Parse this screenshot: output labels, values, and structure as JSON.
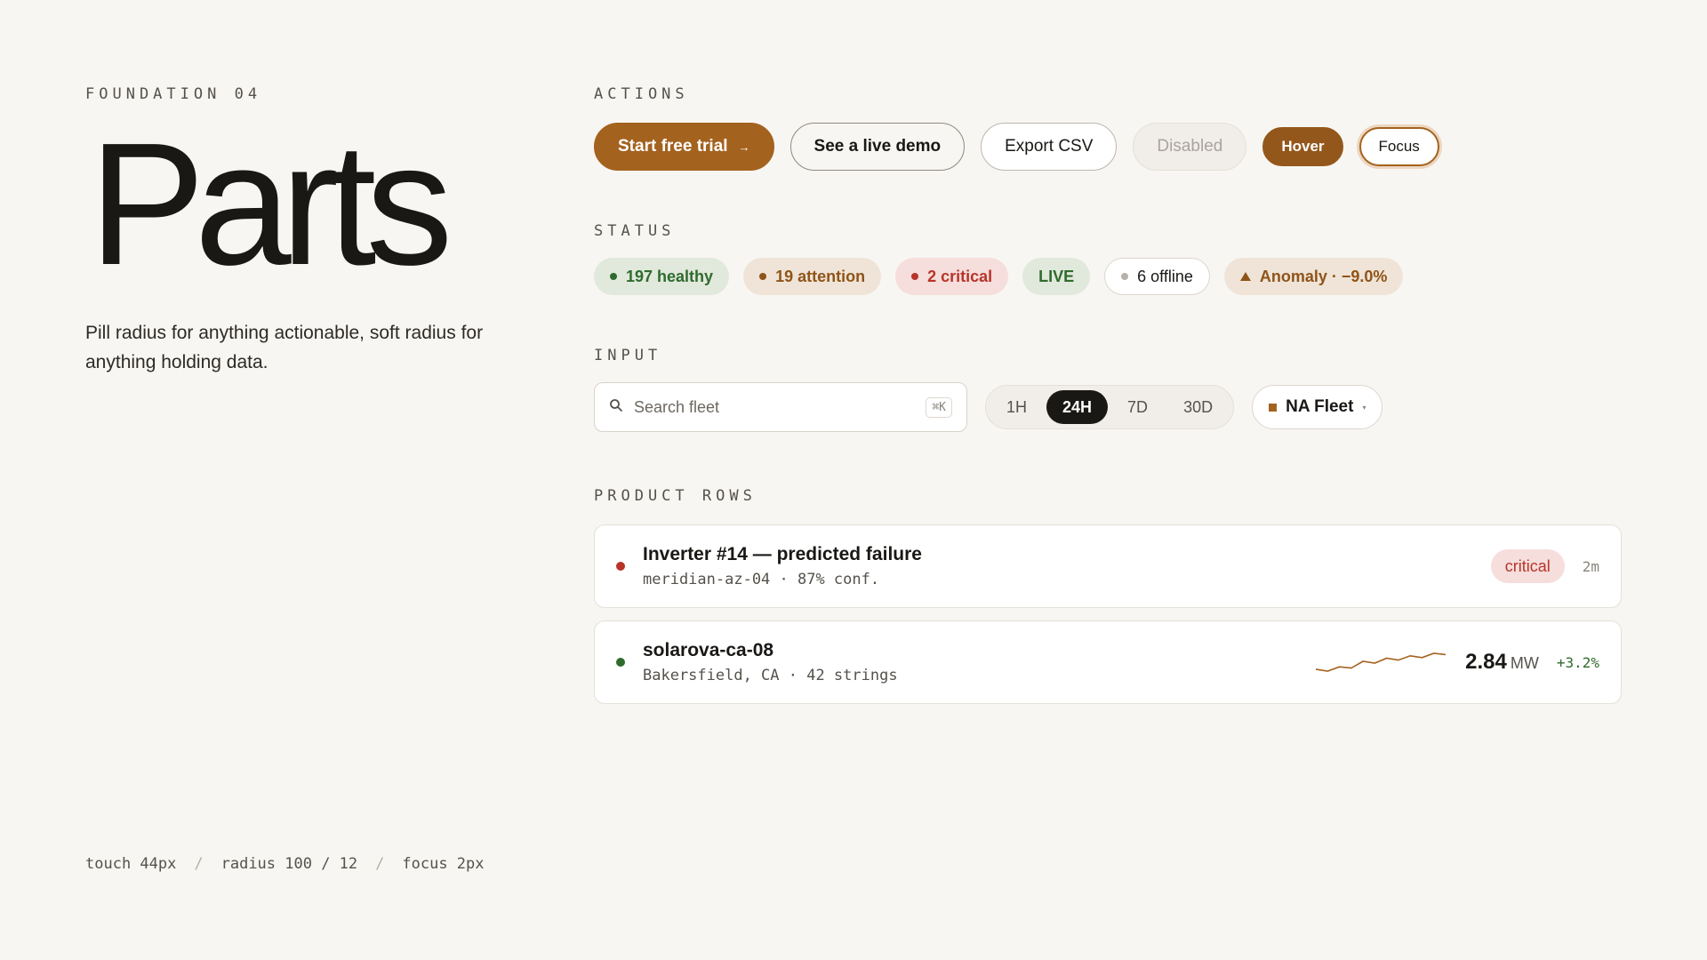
{
  "hero": {
    "eyebrow": "FOUNDATION 04",
    "title": "Parts",
    "description": "Pill radius for anything actionable, soft radius for anything holding data."
  },
  "footer": {
    "items": [
      "touch 44px",
      "radius 100 / 12",
      "focus 2px"
    ],
    "separator": "/"
  },
  "actions": {
    "label": "ACTIONS",
    "start_trial": "Start free trial",
    "arrow": "→",
    "live_demo": "See a live demo",
    "export_csv": "Export CSV",
    "disabled": "Disabled",
    "hover": "Hover",
    "focus": "Focus"
  },
  "status": {
    "label": "STATUS",
    "healthy": "197 healthy",
    "attention": "19 attention",
    "critical": "2 critical",
    "live": "LIVE",
    "offline": "6 offline",
    "anomaly": "Anomaly · −9.0%"
  },
  "input": {
    "label": "INPUT",
    "search_placeholder": "Search fleet",
    "search_shortcut": "⌘K",
    "ranges": [
      "1H",
      "24H",
      "7D",
      "30D"
    ],
    "selected_range": "24H",
    "fleet_select": "NA Fleet",
    "caret": "▾"
  },
  "product_rows": {
    "label": "PRODUCT ROWS",
    "rows": [
      {
        "title": "Inverter #14 — predicted failure",
        "subtitle": "meridian-az-04 · 87% conf.",
        "badge": "critical",
        "age": "2m"
      },
      {
        "title": "solarova-ca-08",
        "subtitle": "Bakersfield, CA · 42 strings",
        "value": "2.84",
        "unit": "MW",
        "delta": "+3.2%",
        "sparkline": [
          3.0,
          3.3,
          2.6,
          2.8,
          1.7,
          2.0,
          1.2,
          1.5,
          0.8,
          1.1,
          0.4,
          0.6
        ]
      }
    ]
  },
  "colors": {
    "background": "#f8f6f2",
    "accent": "#a4621f",
    "healthy": "#2f6b2d",
    "attention": "#8f5419",
    "critical": "#b8342a",
    "ink": "#1a1815"
  }
}
